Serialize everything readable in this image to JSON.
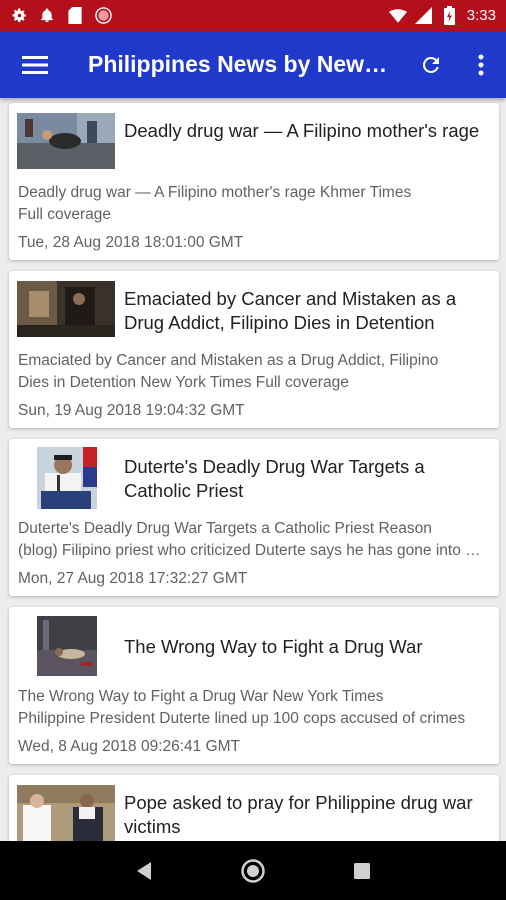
{
  "status_bar": {
    "time": "3:33",
    "icons": [
      "settings-icon",
      "notification-bell-icon",
      "sd-card-icon",
      "record-icon",
      "wifi-icon",
      "signal-icon",
      "battery-icon"
    ]
  },
  "app_bar": {
    "title": "Philippines News by New…",
    "menu_icon": "hamburger-menu-icon",
    "refresh_icon": "refresh-icon",
    "overflow_icon": "more-vert-icon",
    "color": "#2039cb"
  },
  "articles": [
    {
      "title": "Deadly drug war — A Filipino mother's rage",
      "desc_line1": "Deadly drug war — A Filipino mother's rage  Khmer Times",
      "desc_line2": "Full coverage",
      "date": "Tue, 28 Aug 2018 18:01:00 GMT"
    },
    {
      "title": "Emaciated by Cancer and Mistaken as a Drug Addict, Filipino Dies in Detention",
      "desc_line1": "Emaciated by Cancer and Mistaken as a Drug Addict, Filipino",
      "desc_line2": "Dies in Detention  New York Times  Full coverage",
      "date": "Sun, 19 Aug 2018 19:04:32 GMT"
    },
    {
      "title": "Duterte's Deadly Drug War Targets a Catholic Priest",
      "desc_line1": "Duterte's Deadly Drug War Targets a Catholic Priest  Reason",
      "desc_line2": "(blog)  Filipino priest who criticized Duterte says he has gone into hiding",
      "date": "Mon, 27 Aug 2018 17:32:27 GMT"
    },
    {
      "title": "The Wrong Way to Fight a Drug War",
      "desc_line1": "The Wrong Way to Fight a Drug War  New York Times",
      "desc_line2": "Philippine President Duterte lined up 100 cops accused of crimes",
      "date": "Wed, 8 Aug 2018 09:26:41 GMT"
    },
    {
      "title": "Pope asked to pray for Philippine drug war victims",
      "desc_line1": "",
      "desc_line2": "",
      "date": ""
    }
  ],
  "nav_bar": {
    "back_icon": "back-triangle-icon",
    "home_icon": "home-circle-icon",
    "recents_icon": "recents-square-icon"
  }
}
